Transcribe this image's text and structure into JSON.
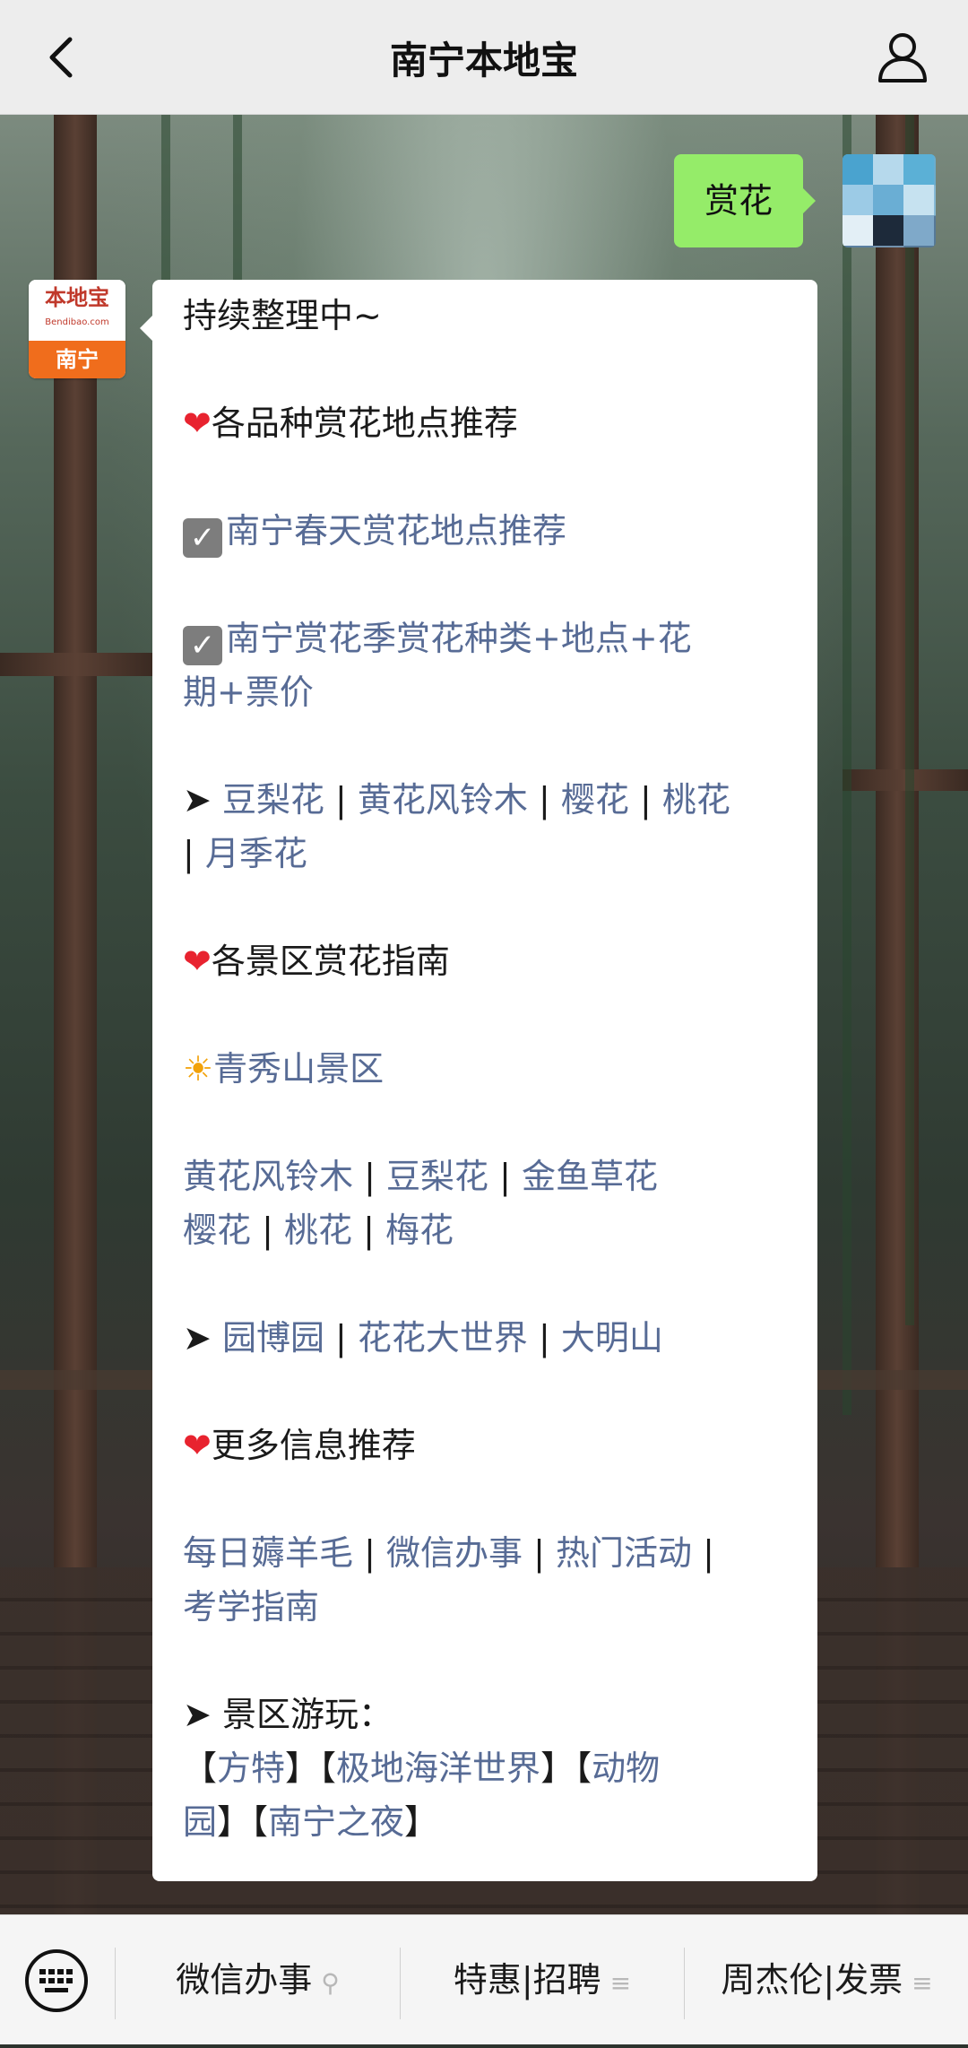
{
  "header": {
    "title": "南宁本地宝",
    "back_icon": "chevron-left-icon",
    "profile_icon": "person-icon"
  },
  "chat": {
    "user_message": "赏花",
    "bot_avatar": {
      "logo_text": "本地宝",
      "logo_url": "Bendibao.com",
      "city": "南宁"
    },
    "bot_message": {
      "line1": "持续整理中~",
      "section1_title": "各品种赏花地点推荐",
      "link1": "南宁春天赏花地点推荐",
      "link2_a": "南宁赏花季赏花种类+地点+花",
      "link2_b": "期+票价",
      "flowers": [
        "豆梨花",
        "黄花风铃木",
        "樱花",
        "桃花",
        "月季花"
      ],
      "section2_title": "各景区赏花指南",
      "scenic1": "青秀山景区",
      "scenic1_flowers_row1": [
        "黄花风铃木",
        "豆梨花",
        "金鱼草花"
      ],
      "scenic1_flowers_row2": [
        "樱花",
        "桃花",
        "梅花"
      ],
      "parks": [
        "园博园",
        "花花大世界",
        "大明山"
      ],
      "section3_title": "更多信息推荐",
      "more_row1": [
        "每日薅羊毛",
        "微信办事",
        "热门活动"
      ],
      "more_row2": [
        "考学指南"
      ],
      "tour_title": "景区游玩：",
      "tour_row1": [
        "方特",
        "极地海洋世界",
        "动物"
      ],
      "tour_row2": [
        "园",
        "南宁之夜"
      ]
    }
  },
  "menu": {
    "keyboard_icon": "keyboard-icon",
    "items": [
      {
        "label": "微信办事",
        "mark": "⚲"
      },
      {
        "label": "特惠|招聘",
        "mark": "≡"
      },
      {
        "label": "周杰伦|发票",
        "mark": "≡"
      }
    ]
  },
  "colors": {
    "header_bg": "#ededed",
    "user_bubble": "#95ec69",
    "link": "#576b95",
    "heart": "#e8232f",
    "menu_bg": "#f5f5f5"
  }
}
